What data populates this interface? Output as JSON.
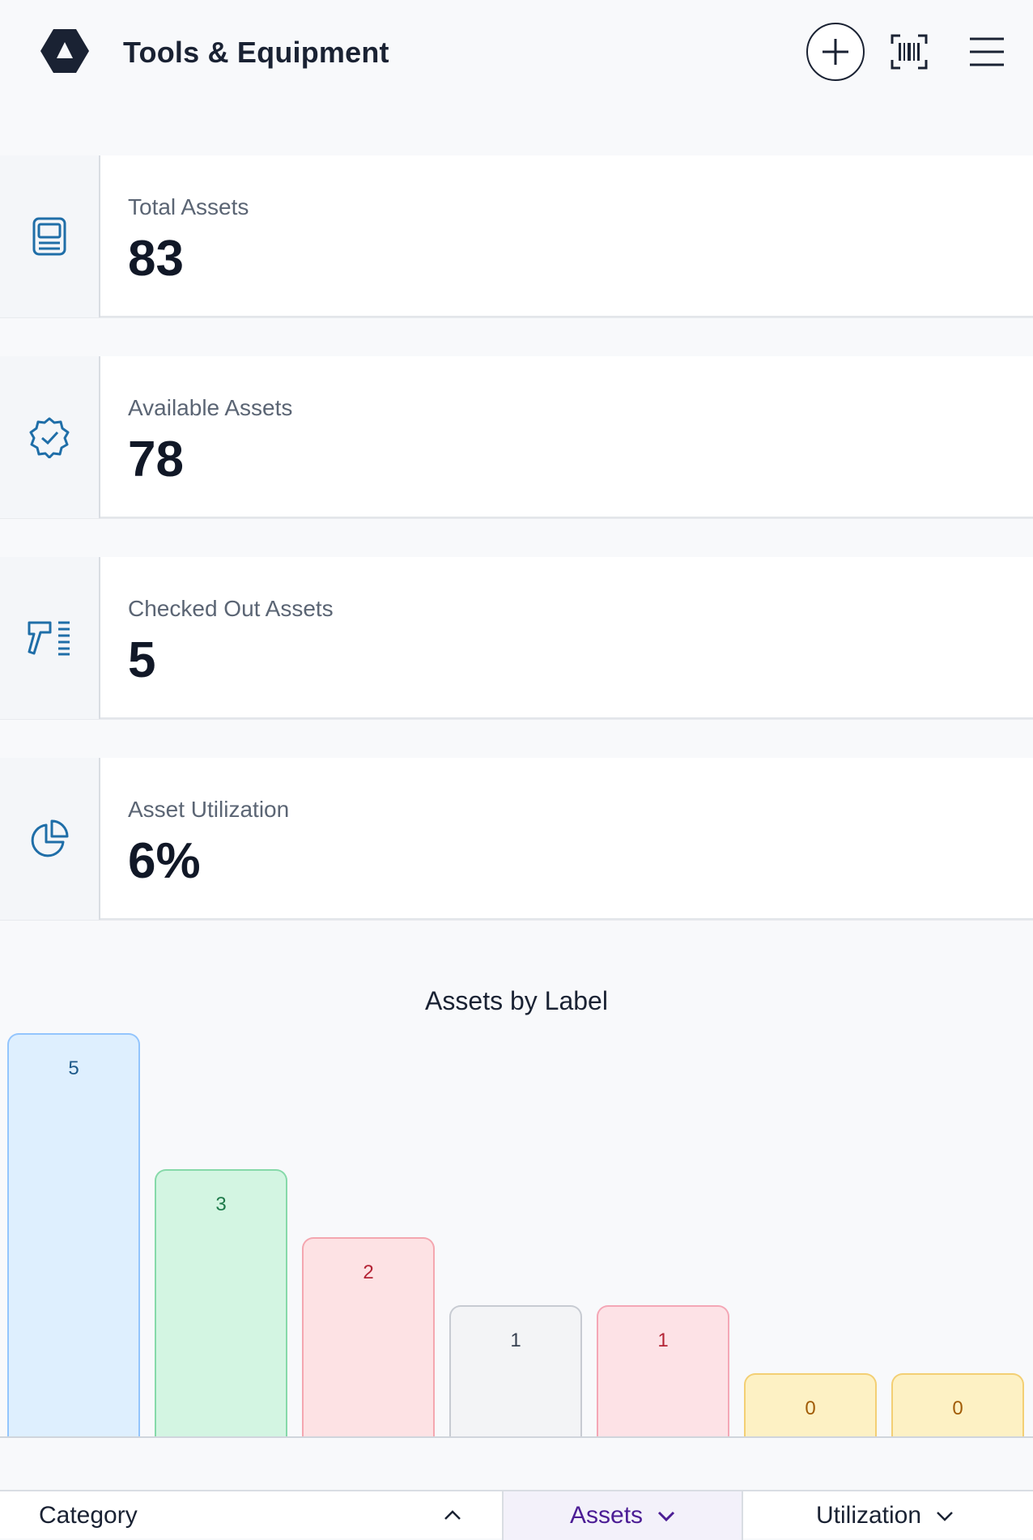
{
  "app": {
    "title": "Tools & Equipment",
    "icons": {
      "logo": "logo-icon",
      "add": "plus-icon",
      "scan": "barcode-icon",
      "menu": "hamburger-icon"
    }
  },
  "stats": [
    {
      "label": "Total Assets",
      "value": "83",
      "icon": "device-icon"
    },
    {
      "label": "Available Assets",
      "value": "78",
      "icon": "check-badge-icon"
    },
    {
      "label": "Checked Out Assets",
      "value": "5",
      "icon": "scanner-list-icon"
    },
    {
      "label": "Asset Utilization",
      "value": "6%",
      "icon": "pie-chart-icon"
    }
  ],
  "chart_data": {
    "type": "bar",
    "title": "Assets by Label",
    "values": [
      5,
      3,
      2,
      1,
      1,
      0,
      0
    ],
    "colors": [
      {
        "fill": "#deeffe",
        "stroke": "#93c5fd",
        "text": "#1e5a8a"
      },
      {
        "fill": "#d3f5e2",
        "stroke": "#86d9a9",
        "text": "#1e7a4a"
      },
      {
        "fill": "#fde2e4",
        "stroke": "#f4a7b0",
        "text": "#b42335"
      },
      {
        "fill": "#f3f4f6",
        "stroke": "#c7cbd2",
        "text": "#374151"
      },
      {
        "fill": "#fde2e6",
        "stroke": "#f4a7b6",
        "text": "#b42335"
      },
      {
        "fill": "#fdf1c4",
        "stroke": "#f3cf74",
        "text": "#a15c07"
      },
      {
        "fill": "#fdf1c4",
        "stroke": "#f3cf74",
        "text": "#a15c07"
      }
    ]
  },
  "table": {
    "columns": {
      "category": "Category",
      "assets": "Assets",
      "utilization": "Utilization"
    }
  }
}
